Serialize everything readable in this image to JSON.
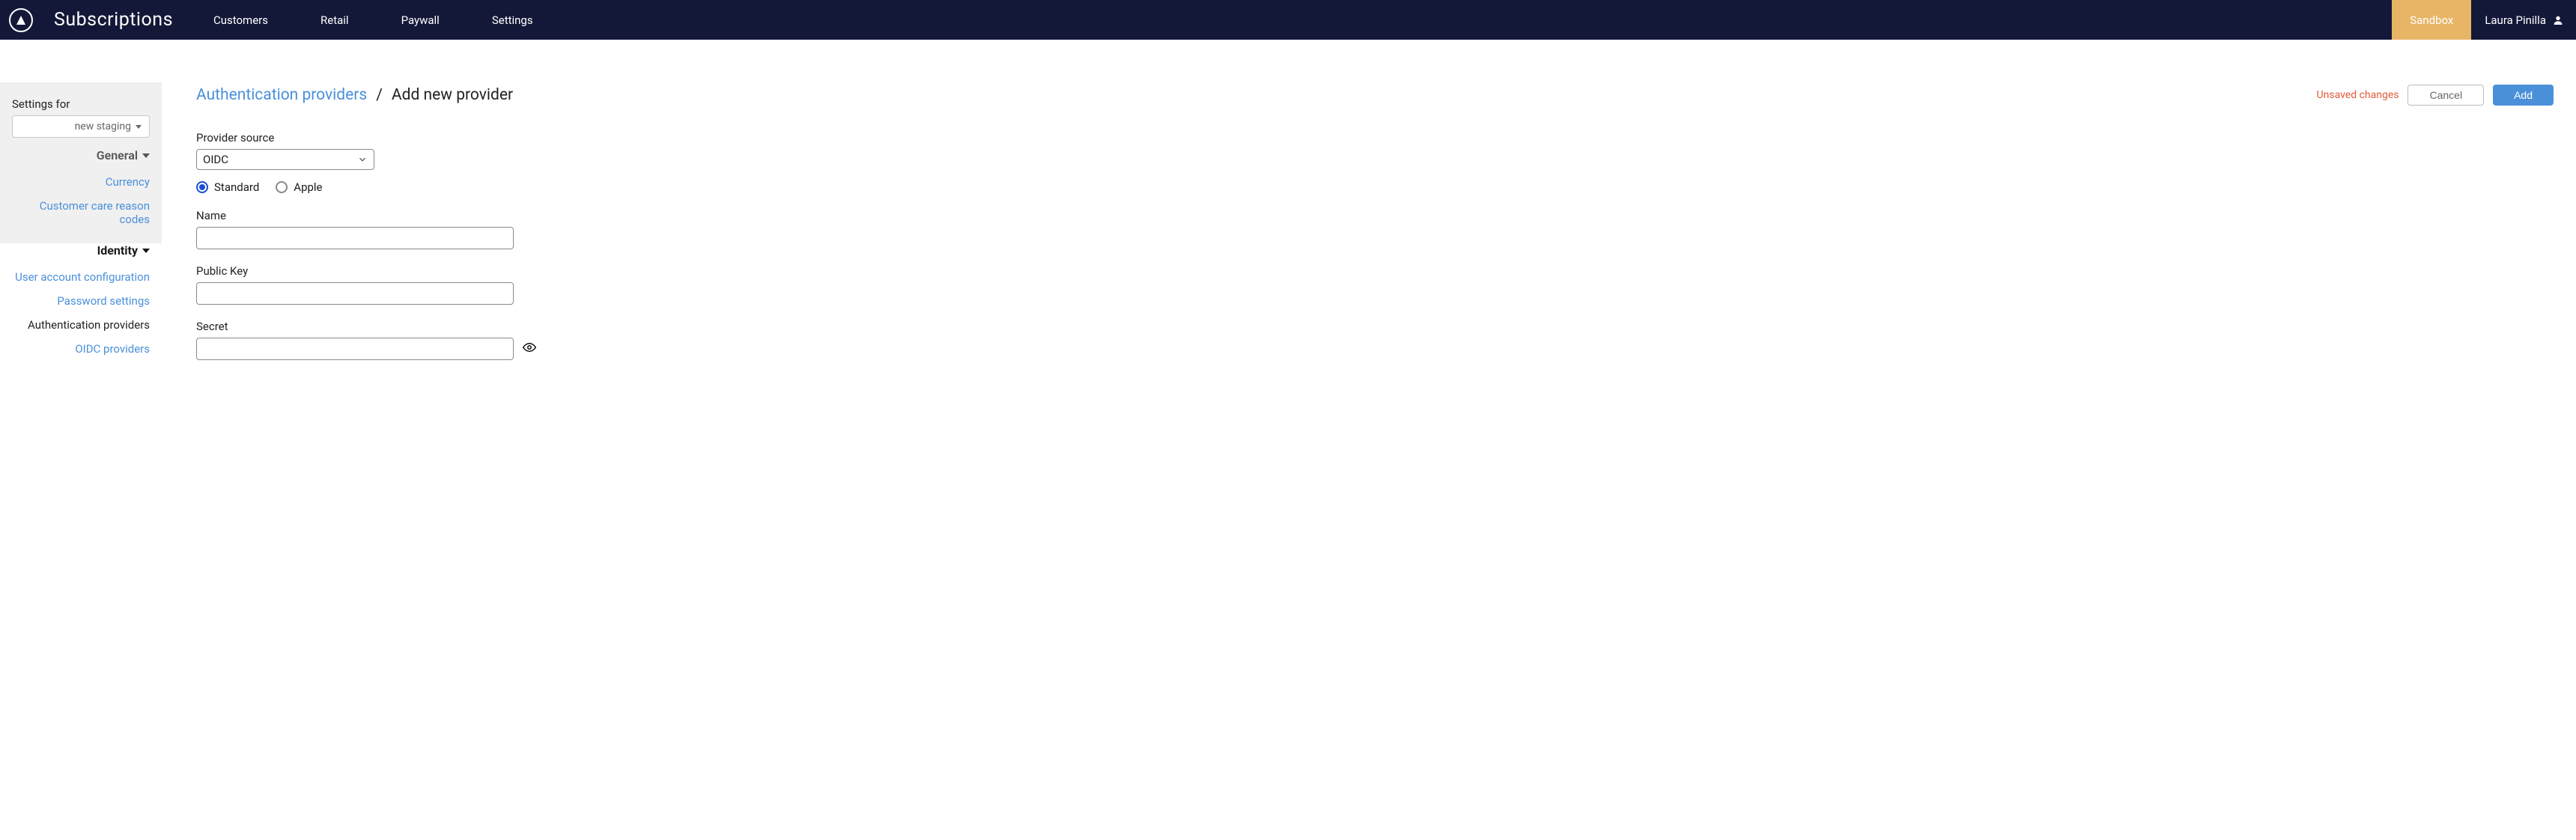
{
  "header": {
    "app_title": "Subscriptions",
    "nav": [
      "Customers",
      "Retail",
      "Paywall",
      "Settings"
    ],
    "sandbox_label": "Sandbox",
    "user_name": "Laura Pinilla"
  },
  "sidebar": {
    "settings_for_label": "Settings for",
    "environment_selected": "new staging",
    "groups": {
      "general": {
        "title": "General",
        "items": [
          "Currency",
          "Customer care reason codes"
        ]
      },
      "identity": {
        "title": "Identity",
        "items": [
          "User account configuration",
          "Password settings",
          "Authentication providers",
          "OIDC providers"
        ],
        "active_index": 2
      }
    }
  },
  "main": {
    "breadcrumb_parent": "Authentication providers",
    "breadcrumb_sep": "/",
    "breadcrumb_current": "Add new provider",
    "unsaved_text": "Unsaved changes",
    "cancel_label": "Cancel",
    "add_label": "Add",
    "form": {
      "provider_source_label": "Provider source",
      "provider_source_value": "OIDC",
      "radio_standard": "Standard",
      "radio_apple": "Apple",
      "name_label": "Name",
      "name_value": "",
      "public_key_label": "Public Key",
      "public_key_value": "",
      "secret_label": "Secret",
      "secret_value": ""
    }
  }
}
